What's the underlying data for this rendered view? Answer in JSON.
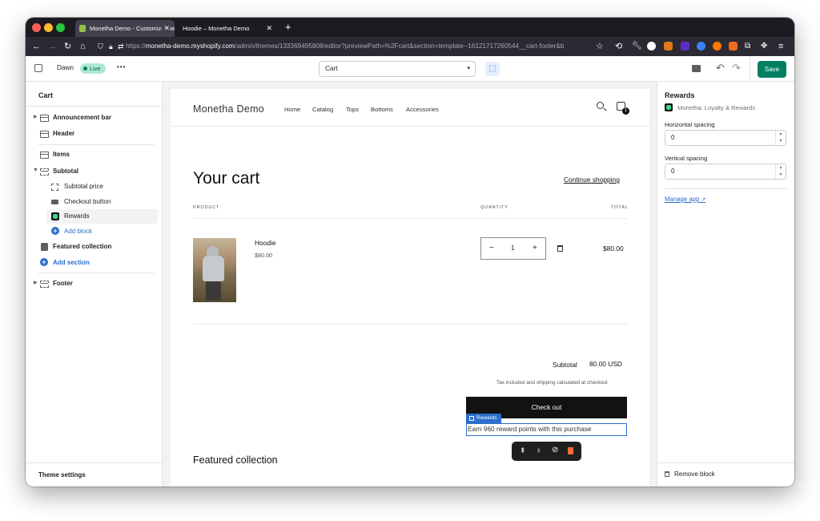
{
  "browser": {
    "tabs": [
      {
        "title": "Monetha Demo - Customize Daw",
        "active": true
      },
      {
        "title": "Hoodie – Monetha Demo",
        "active": false
      }
    ],
    "url_prefix": "https://",
    "url_host": "monetha-demo.myshopify.com",
    "url_path": "/admin/themes/133369495808/editor?previewPath=%2Fcart&section=template--16121717260544__cart-footer&b"
  },
  "editor": {
    "theme_name": "Dawn",
    "live_badge": "Live",
    "more": "•••",
    "page_select": "Cart",
    "save_label": "Save"
  },
  "sidebar": {
    "title": "Cart",
    "items": [
      {
        "label": "Announcement bar"
      },
      {
        "label": "Header"
      },
      {
        "label": "Items"
      },
      {
        "label": "Subtotal"
      },
      {
        "label": "Subtotal price"
      },
      {
        "label": "Checkout button"
      },
      {
        "label": "Rewards"
      },
      {
        "label": "Add block"
      },
      {
        "label": "Featured collection"
      },
      {
        "label": "Add section"
      },
      {
        "label": "Footer"
      }
    ],
    "theme_settings": "Theme settings"
  },
  "store": {
    "name": "Monetha Demo",
    "nav": [
      "Home",
      "Catalog",
      "Tops",
      "Bottoms",
      "Accessories"
    ],
    "cart_count": "1",
    "cart_title": "Your cart",
    "continue_shopping": "Continue shopping",
    "col_product": "PRODUCT",
    "col_quantity": "QUANTITY",
    "col_total": "TOTAL",
    "product_name": "Hoodie",
    "product_price": "$80.00",
    "quantity": "1",
    "qty_minus": "−",
    "qty_plus": "+",
    "line_total": "$80.00",
    "subtotal_label": "Subtotal",
    "subtotal_value": "80.00 USD",
    "tax_note": "Tax included and shipping calculated at checkout",
    "checkout": "Check out",
    "rewards_tag": "Rewards",
    "rewards_text": "Earn 960 reward points with this purchase",
    "featured": "Featured collection"
  },
  "panel": {
    "title": "Rewards",
    "app_name": "Monetha: Loyalty & Rewards",
    "h_label": "Horizontal spacing",
    "h_value": "0",
    "v_label": "Vertical spacing",
    "v_value": "0",
    "manage": "Manage app",
    "remove": "Remove block"
  },
  "colors": {
    "save": "#008060",
    "live_bg": "#aee9d1",
    "link": "#2c6ecb",
    "selection": "#2c6ecb",
    "checkout_bg": "#121212"
  }
}
